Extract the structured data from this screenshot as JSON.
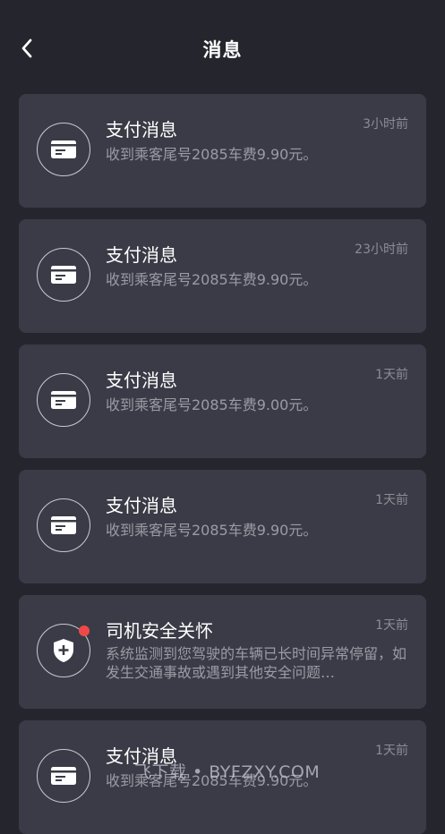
{
  "header": {
    "title": "消息",
    "back_icon": "chevron-left-icon"
  },
  "messages": [
    {
      "type": "payment",
      "icon": "card-icon",
      "title": "支付消息",
      "time": "3小时前",
      "body": "收到乘客尾号2085车费9.90元。",
      "unread": false
    },
    {
      "type": "payment",
      "icon": "card-icon",
      "title": "支付消息",
      "time": "23小时前",
      "body": "收到乘客尾号2085车费9.90元。",
      "unread": false
    },
    {
      "type": "payment",
      "icon": "card-icon",
      "title": "支付消息",
      "time": "1天前",
      "body": "收到乘客尾号2085车费9.00元。",
      "unread": false
    },
    {
      "type": "payment",
      "icon": "card-icon",
      "title": "支付消息",
      "time": "1天前",
      "body": "收到乘客尾号2085车费9.90元。",
      "unread": false
    },
    {
      "type": "safety",
      "icon": "shield-plus-icon",
      "title": "司机安全关怀",
      "time": "1天前",
      "body": "系统监测到您驾驶的车辆已长时间异常停留，如发生交通事故或遇到其他安全问题…",
      "unread": true
    },
    {
      "type": "payment",
      "icon": "card-icon",
      "title": "支付消息",
      "time": "1天前",
      "body": "收到乘客尾号2085车费9.90元。",
      "unread": false
    }
  ],
  "watermark": "飞下载 • BYFZXY.COM",
  "colors": {
    "background": "#25262d",
    "card": "#3a3b46",
    "unread_dot": "#f04848",
    "secondary_text": "#9a9ba4"
  }
}
